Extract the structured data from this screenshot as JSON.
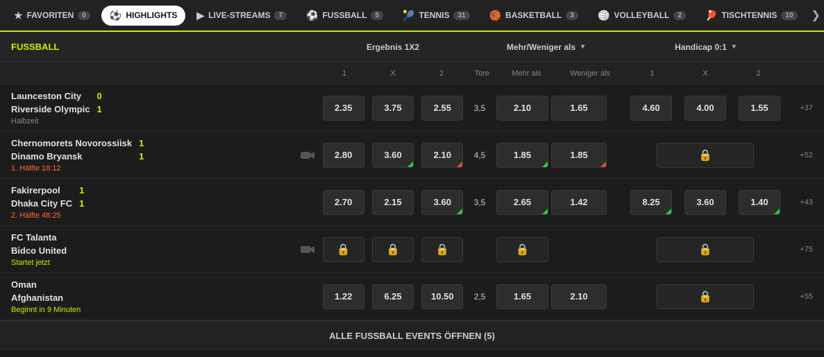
{
  "nav": {
    "items": [
      {
        "id": "favoriten",
        "label": "FAVORITEN",
        "badge": "0",
        "icon": "★",
        "active": false
      },
      {
        "id": "highlights",
        "label": "HIGHLIGHTS",
        "badge": "",
        "icon": "⚽",
        "active": true
      },
      {
        "id": "live-streams",
        "label": "LIVE-STREAMS",
        "badge": "7",
        "icon": "▶",
        "active": false
      },
      {
        "id": "fussball",
        "label": "FUSSBALL",
        "badge": "5",
        "icon": "⚽",
        "active": false
      },
      {
        "id": "tennis",
        "label": "TENNIS",
        "badge": "31",
        "icon": "🎾",
        "active": false
      },
      {
        "id": "basketball",
        "label": "BASKETBALL",
        "badge": "3",
        "icon": "🏀",
        "active": false
      },
      {
        "id": "volleyball",
        "label": "VOLLEYBALL",
        "badge": "2",
        "icon": "🏐",
        "active": false
      },
      {
        "id": "tischtennis",
        "label": "TISCHTENNIS",
        "badge": "10",
        "icon": "🏓",
        "active": false
      }
    ],
    "chevron": "❯"
  },
  "section": {
    "title": "FUSSBALL",
    "col_ergebnis": "Ergebnis 1X2",
    "col_mehr": "Mehr/Weniger als",
    "col_handicap": "Handicap 0:1",
    "labels": {
      "one": "1",
      "x": "X",
      "two": "2",
      "tore": "Tore",
      "mehr_als": "Mehr als",
      "weniger_als": "Weniger als",
      "h1": "1",
      "hx": "X",
      "h2": "2"
    }
  },
  "matches": [
    {
      "id": "m1",
      "team1": "Launceston City",
      "team2": "Riverside Olympic",
      "score1": "0",
      "score2": "1",
      "status": "Halbzeit",
      "status_type": "normal",
      "has_camera": false,
      "odds_1": "2.35",
      "odds_x": "3.75",
      "odds_2": "2.55",
      "odds_1_dir": "",
      "odds_x_dir": "",
      "odds_2_dir": "",
      "tore": "3,5",
      "mehr": "2.10",
      "weniger": "1.65",
      "mehr_dir": "",
      "weniger_dir": "",
      "h1": "4.60",
      "hx": "4.00",
      "h2": "1.55",
      "h1_dir": "",
      "hx_dir": "",
      "h2_dir": "",
      "h_locked": false,
      "plus": "+37"
    },
    {
      "id": "m2",
      "team1": "Chernomorets Novorossiisk",
      "team2": "Dinamo Bryansk",
      "score1": "1",
      "score2": "1",
      "status": "1. Hälfte 18:12",
      "status_type": "live",
      "has_camera": true,
      "odds_1": "2.80",
      "odds_x": "3.60",
      "odds_2": "2.10",
      "odds_1_dir": "",
      "odds_x_dir": "up",
      "odds_2_dir": "down",
      "tore": "4,5",
      "mehr": "1.85",
      "weniger": "1.85",
      "mehr_dir": "up",
      "weniger_dir": "down",
      "h1": "",
      "hx": "",
      "h2": "",
      "h1_dir": "",
      "hx_dir": "",
      "h2_dir": "",
      "h_locked": true,
      "plus": "+52"
    },
    {
      "id": "m3",
      "team1": "Fakirerpool",
      "team2": "Dhaka City FC",
      "score1": "1",
      "score2": "1",
      "status": "2. Hälfte 48:25",
      "status_type": "live",
      "has_camera": false,
      "odds_1": "2.70",
      "odds_x": "2.15",
      "odds_2": "3.60",
      "odds_1_dir": "",
      "odds_x_dir": "",
      "odds_2_dir": "up",
      "tore": "3,5",
      "mehr": "2.65",
      "weniger": "1.42",
      "mehr_dir": "up",
      "weniger_dir": "",
      "h1": "8.25",
      "hx": "3.60",
      "h2": "1.40",
      "h1_dir": "up",
      "hx_dir": "",
      "h2_dir": "up",
      "h_locked": false,
      "plus": "+43"
    },
    {
      "id": "m4",
      "team1": "FC Talanta",
      "team2": "Bidco United",
      "score1": "",
      "score2": "",
      "status": "Startet jetzt",
      "status_type": "starts-now",
      "has_camera": true,
      "odds_1": "",
      "odds_x": "",
      "odds_2": "",
      "odds_1_dir": "",
      "odds_x_dir": "",
      "odds_2_dir": "",
      "tore": "",
      "mehr": "",
      "weniger": "",
      "mehr_dir": "",
      "weniger_dir": "",
      "h1": "",
      "hx": "",
      "h2": "",
      "h1_dir": "",
      "hx_dir": "",
      "h2_dir": "",
      "h_locked": true,
      "e_locked": true,
      "m_locked": true,
      "plus": "+75"
    },
    {
      "id": "m5",
      "team1": "Oman",
      "team2": "Afghanistan",
      "score1": "",
      "score2": "",
      "status": "Beginnt in 9 Minuten",
      "status_type": "soon",
      "has_camera": false,
      "odds_1": "1.22",
      "odds_x": "6.25",
      "odds_2": "10.50",
      "odds_1_dir": "",
      "odds_x_dir": "",
      "odds_2_dir": "",
      "tore": "2,5",
      "mehr": "1.65",
      "weniger": "2.10",
      "mehr_dir": "",
      "weniger_dir": "",
      "h1": "",
      "hx": "",
      "h2": "",
      "h1_dir": "",
      "hx_dir": "",
      "h2_dir": "",
      "h_locked": true,
      "e_locked": false,
      "m_locked": false,
      "plus": "+55"
    }
  ],
  "footer": {
    "label": "ALLE FUSSBALL EVENTS ÖFFNEN (5)"
  }
}
